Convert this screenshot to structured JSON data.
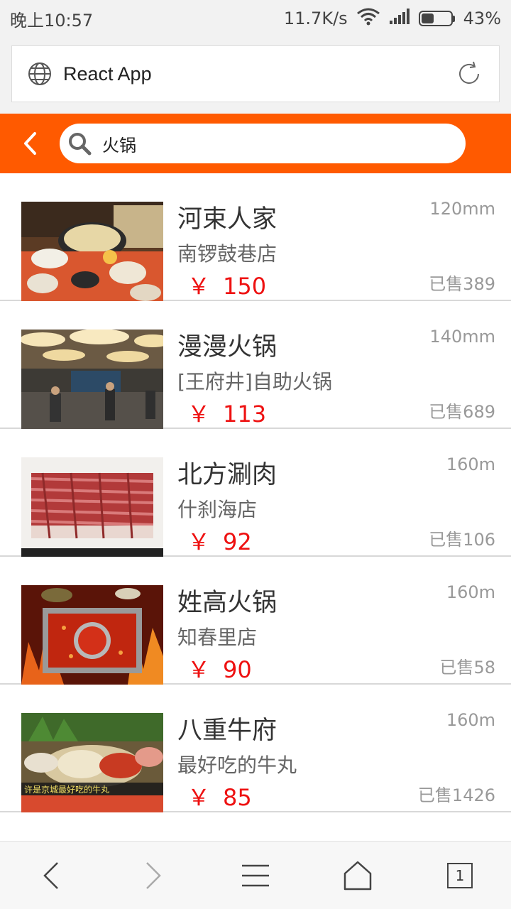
{
  "status_bar": {
    "time": "晚上10:57",
    "speed": "11.7K/s",
    "battery": "43%",
    "battery_level": 0.43
  },
  "browser": {
    "title": "React App"
  },
  "search": {
    "value": "火锅"
  },
  "colors": {
    "header": "#ff5a00",
    "price": "#ee1111"
  },
  "items": [
    {
      "name": "河束人家",
      "subtitle": "南锣鼓巷店",
      "currency": "￥",
      "price": "150",
      "distance": "120mm",
      "sold": "已售389"
    },
    {
      "name": "漫漫火锅",
      "subtitle": "[王府井]自助火锅",
      "currency": "￥",
      "price": "113",
      "distance": "140mm",
      "sold": "已售689"
    },
    {
      "name": "北方涮肉",
      "subtitle": "什刹海店",
      "currency": "￥",
      "price": "92",
      "distance": "160m",
      "sold": "已售106"
    },
    {
      "name": "姓高火锅",
      "subtitle": "知春里店",
      "currency": "￥",
      "price": "90",
      "distance": "160m",
      "sold": "已售58"
    },
    {
      "name": "八重牛府",
      "subtitle": "最好吃的牛丸",
      "currency": "￥",
      "price": "85",
      "distance": "160m",
      "sold": "已售1426",
      "image_caption": "许是京城最好吃的牛丸"
    }
  ],
  "bottom_nav": {
    "tab_count": "1"
  }
}
